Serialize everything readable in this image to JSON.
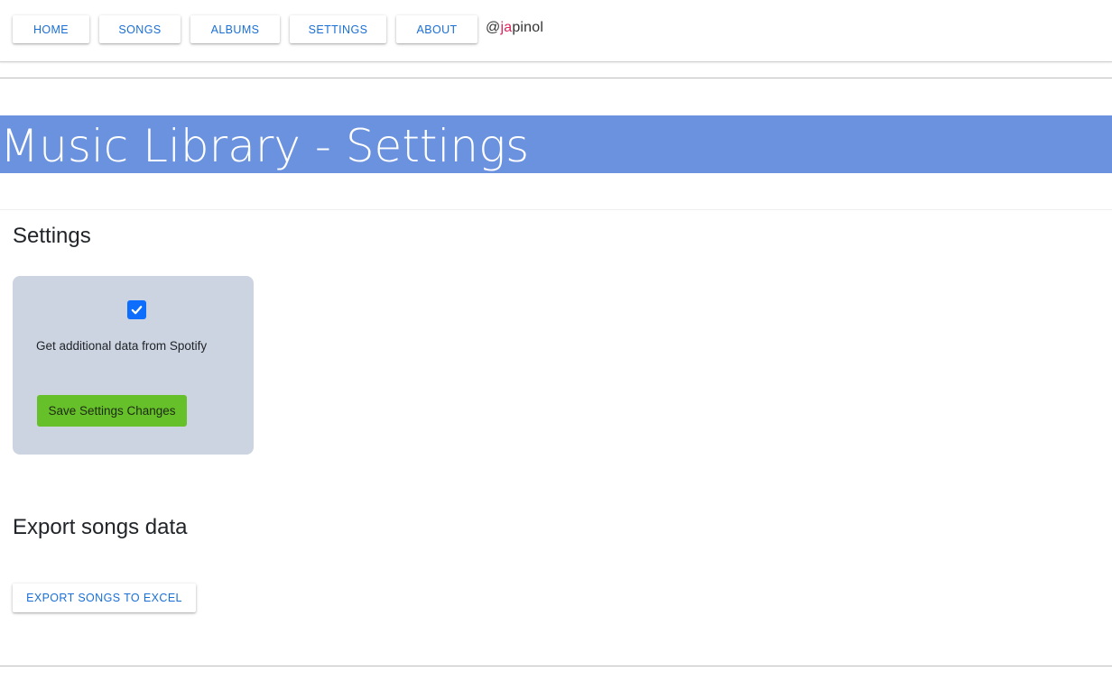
{
  "nav": {
    "items": [
      {
        "label": "HOME"
      },
      {
        "label": "SONGS"
      },
      {
        "label": "ALBUMS"
      },
      {
        "label": "SETTINGS"
      },
      {
        "label": "ABOUT"
      }
    ],
    "brand": {
      "prefix": "@",
      "highlight": "ja",
      "suffix": "pinol"
    }
  },
  "banner": {
    "title": "Music Library - Settings"
  },
  "settings": {
    "heading": "Settings",
    "spotify_checkbox": {
      "checked": true,
      "label": "Get additional data from Spotify"
    },
    "save_label": "Save Settings Changes"
  },
  "export": {
    "heading": "Export songs data",
    "button_label": "EXPORT SONGS TO EXCEL"
  },
  "colors": {
    "banner": "#6b92df",
    "card": "#cdd4e1",
    "save_button": "#66c02a",
    "link_text": "#1a6fd6",
    "checkbox": "#0d6efd",
    "brand_highlight": "#e0245e"
  }
}
